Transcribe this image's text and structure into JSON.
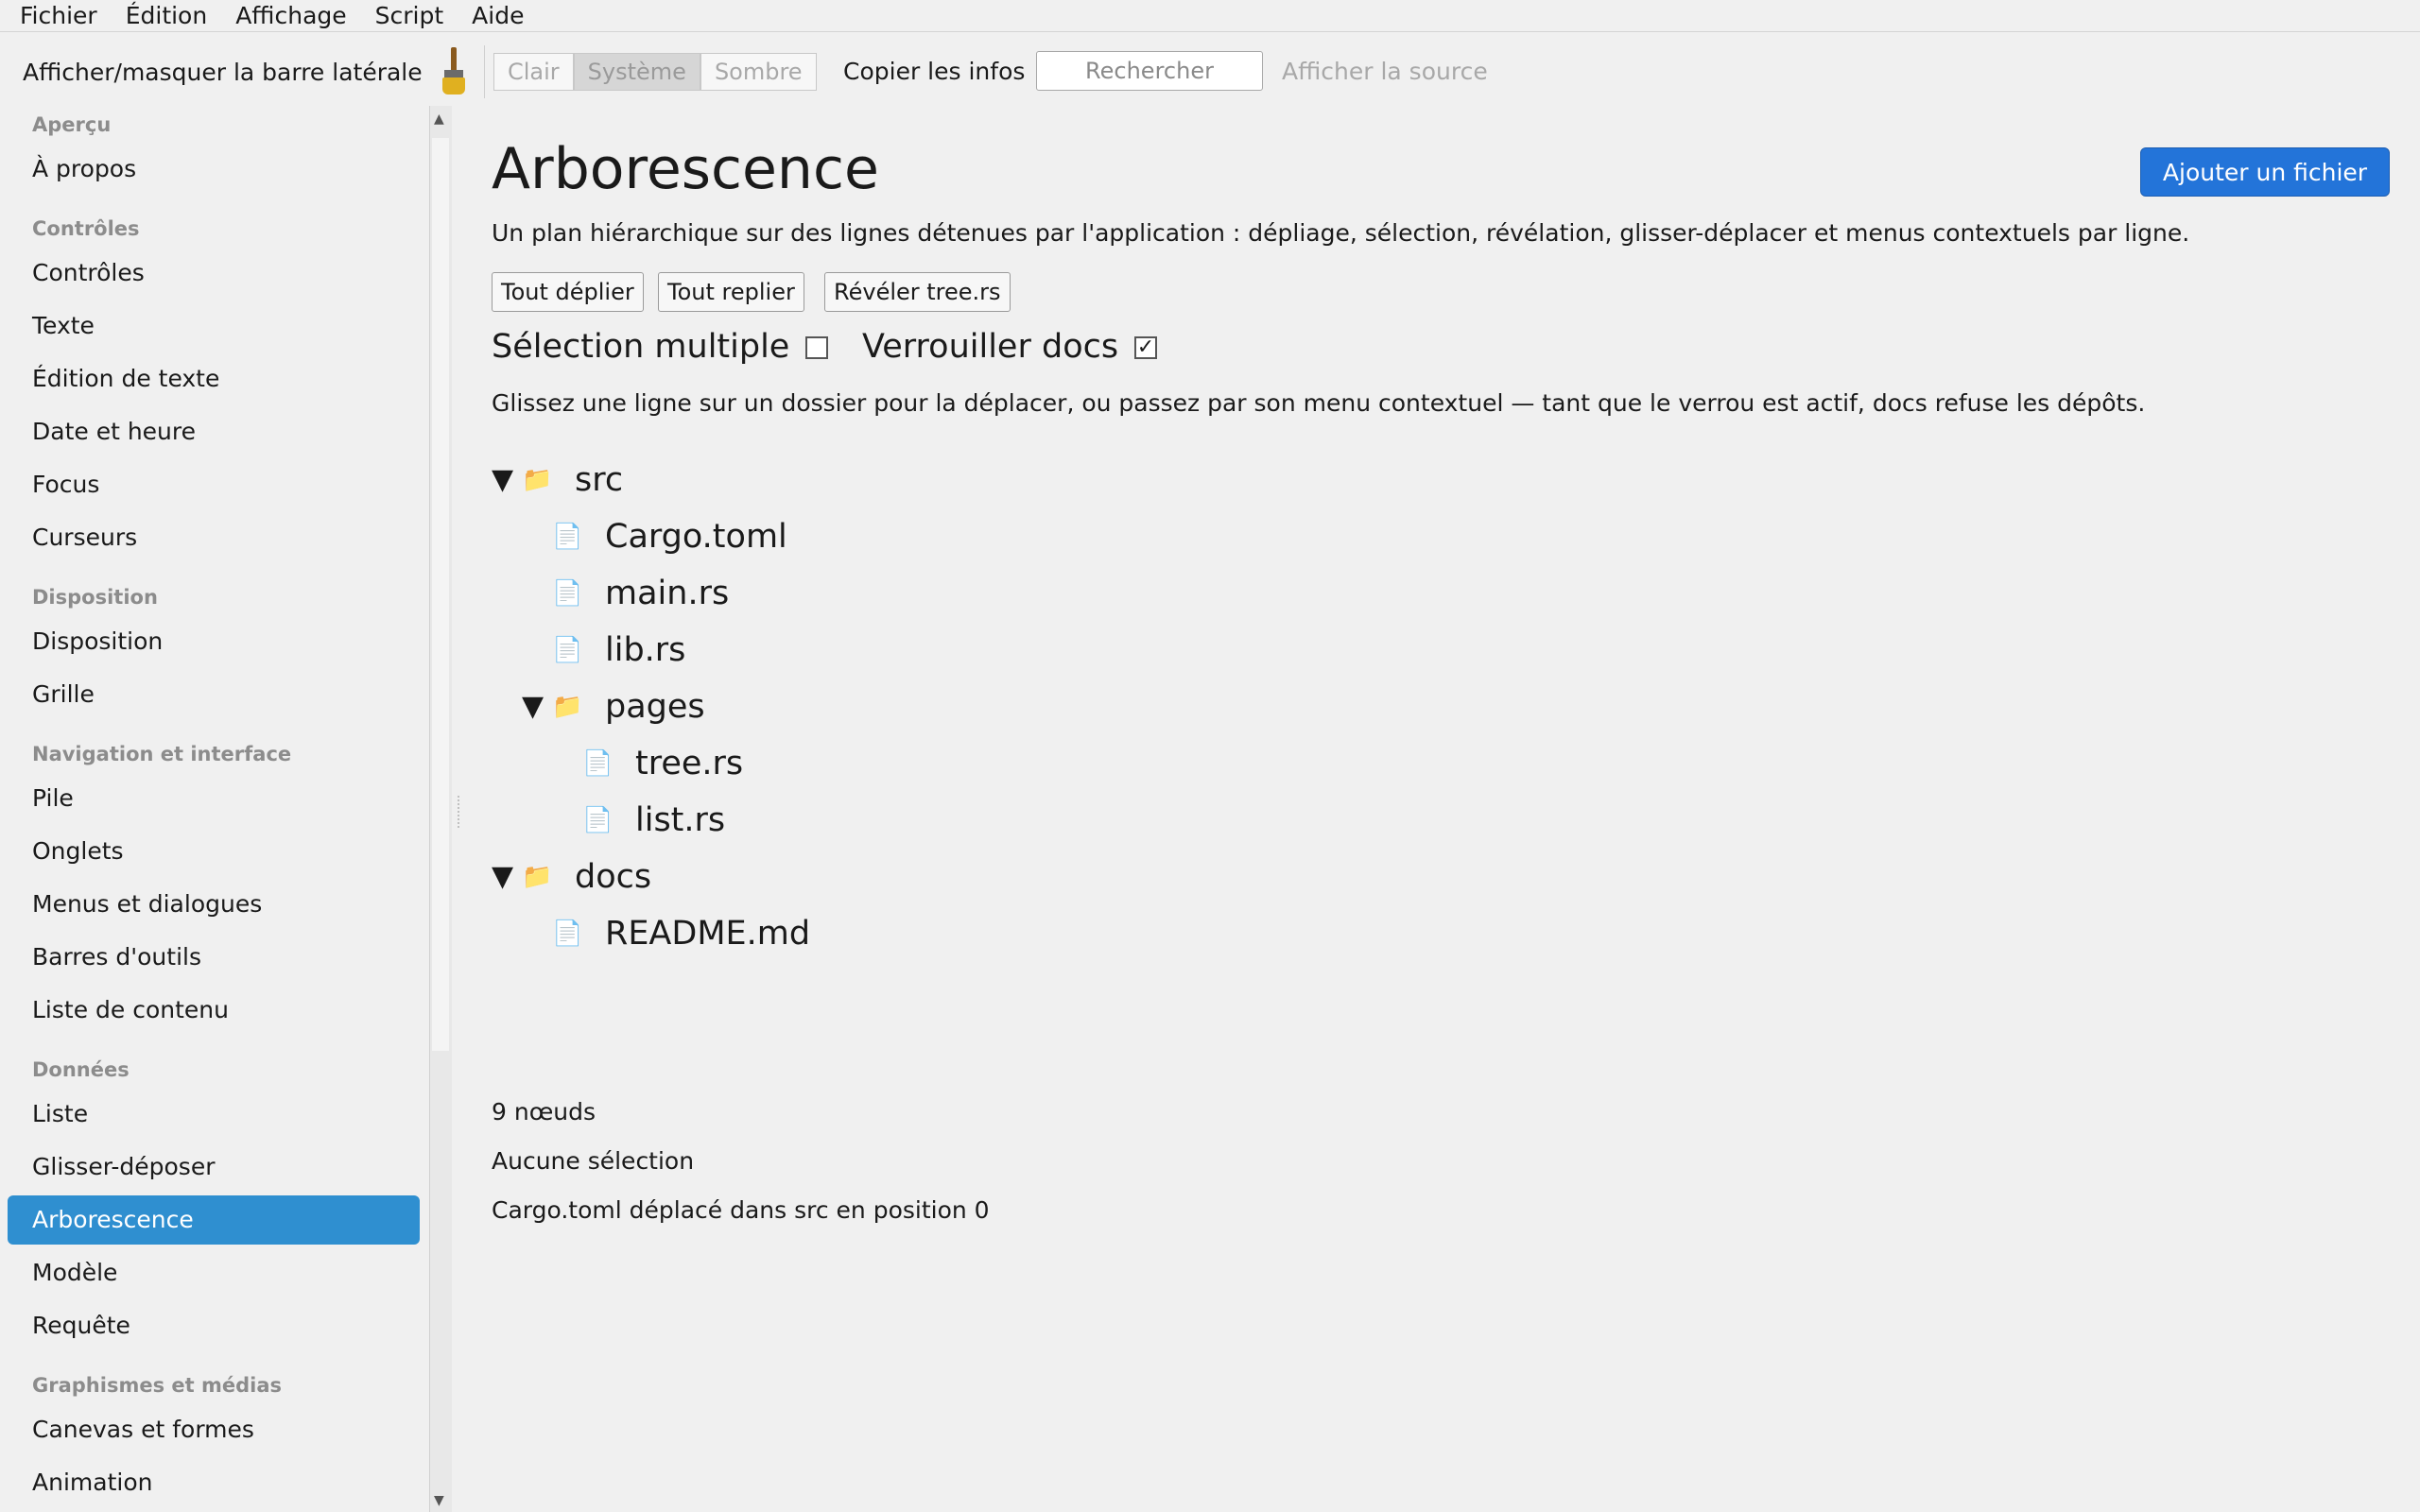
{
  "menubar": [
    "Fichier",
    "Édition",
    "Affichage",
    "Script",
    "Aide"
  ],
  "toolbar": {
    "sidebar_toggle": "Afficher/masquer la barre latérale",
    "theme_buttons": [
      "Clair",
      "Système",
      "Sombre"
    ],
    "active_theme": "Système",
    "copy_info": "Copier les infos",
    "search_placeholder": "Rechercher",
    "view_source": "Afficher la source"
  },
  "sidebar": {
    "sections": [
      {
        "header": "Aperçu",
        "items": [
          "À propos"
        ]
      },
      {
        "header": "Contrôles",
        "items": [
          "Contrôles",
          "Texte",
          "Édition de texte",
          "Date et heure",
          "Focus",
          "Curseurs"
        ]
      },
      {
        "header": "Disposition",
        "items": [
          "Disposition",
          "Grille"
        ]
      },
      {
        "header": "Navigation et interface",
        "items": [
          "Pile",
          "Onglets",
          "Menus et dialogues",
          "Barres d'outils",
          "Liste de contenu"
        ]
      },
      {
        "header": "Données",
        "items": [
          "Liste",
          "Glisser-déposer",
          "Arborescence",
          "Modèle",
          "Requête"
        ]
      },
      {
        "header": "Graphismes et médias",
        "items": [
          "Canevas et formes",
          "Animation"
        ]
      }
    ],
    "selected": "Arborescence"
  },
  "main": {
    "title": "Arborescence",
    "add_button": "Ajouter un fichier",
    "description": "Un plan hiérarchique sur des lignes détenues par l'application : dépliage, sélection, révélation, glisser-déplacer et menus contextuels par ligne.",
    "actions": [
      "Tout déplier",
      "Tout replier",
      "Révéler tree.rs"
    ],
    "multi_select": {
      "label": "Sélection multiple",
      "checked": false
    },
    "lock_docs": {
      "label": "Verrouiller docs",
      "checked": true,
      "check_mark": "✓"
    },
    "hint": "Glissez une ligne sur un dossier pour la déplacer, ou passez par son menu contextuel — tant que le verrou est actif, docs refuse les dépôts.",
    "tree": [
      {
        "name": "src",
        "type": "folder",
        "depth": 0,
        "expanded": true
      },
      {
        "name": "Cargo.toml",
        "type": "file",
        "depth": 1
      },
      {
        "name": "main.rs",
        "type": "file",
        "depth": 1
      },
      {
        "name": "lib.rs",
        "type": "file",
        "depth": 1
      },
      {
        "name": "pages",
        "type": "folder",
        "depth": 1,
        "expanded": true
      },
      {
        "name": "tree.rs",
        "type": "file",
        "depth": 2
      },
      {
        "name": "list.rs",
        "type": "file",
        "depth": 2
      },
      {
        "name": "docs",
        "type": "folder",
        "depth": 0,
        "expanded": true
      },
      {
        "name": "README.md",
        "type": "file",
        "depth": 1
      }
    ],
    "glyphs": {
      "expanded": "▼",
      "folder": "📁",
      "file": "📄"
    },
    "status": {
      "node_count": "9 nœuds",
      "selection": "Aucune sélection",
      "last_action": "Cargo.toml déplacé dans src en position 0"
    }
  },
  "colors": {
    "selected_bg": "#2f8fd0",
    "primary_button": "#2374d9",
    "folder_icon": "#e8b84a",
    "file_icon": "#9aa8c0"
  }
}
